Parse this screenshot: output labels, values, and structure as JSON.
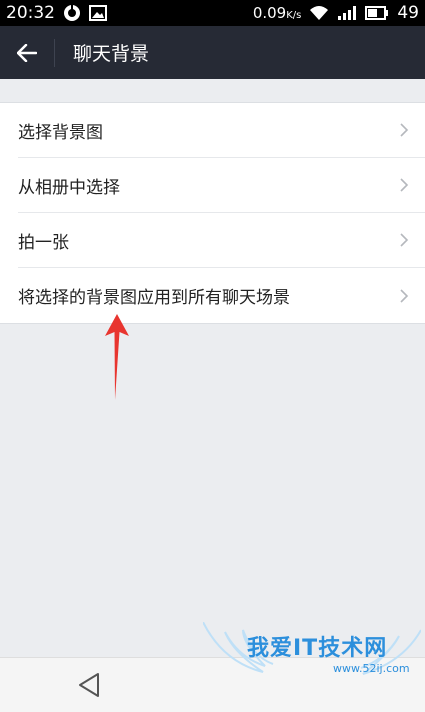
{
  "status_bar": {
    "time": "20:32",
    "net_speed": "0.09",
    "net_speed_unit": "K/s",
    "battery": "49"
  },
  "header": {
    "title": "聊天背景"
  },
  "menu": {
    "items": [
      {
        "label": "选择背景图"
      },
      {
        "label": "从相册中选择"
      },
      {
        "label": "拍一张"
      },
      {
        "label": "将选择的背景图应用到所有聊天场景"
      }
    ]
  },
  "watermark": {
    "text": "我爱IT技术网",
    "url": "www.52ij.com"
  },
  "colors": {
    "header_bg": "#262a35",
    "page_bg": "#ebedf0",
    "annotation_arrow": "#e8352f"
  }
}
